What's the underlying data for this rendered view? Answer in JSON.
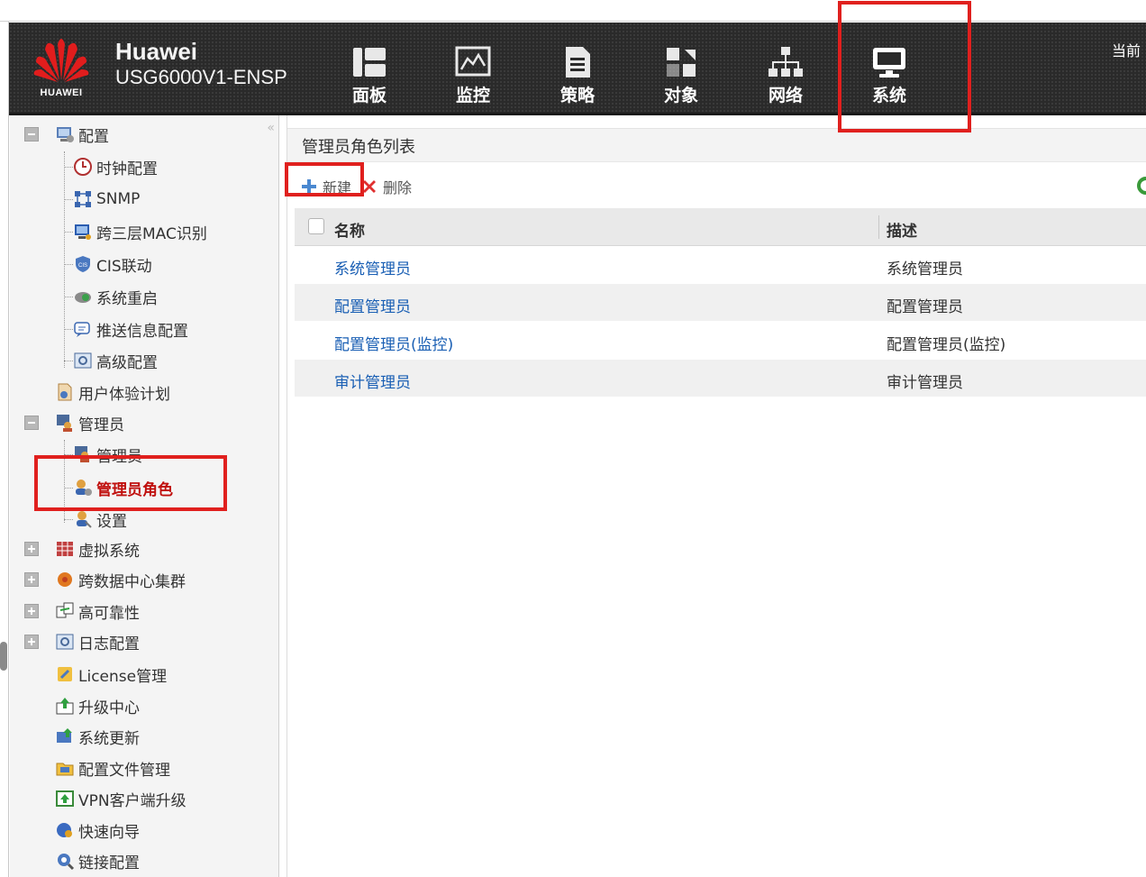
{
  "header": {
    "logo_text": "HUAWEI",
    "brand_line1": "Huawei",
    "brand_line2": "USG6000V1-ENSP",
    "current_user_prefix": "当前",
    "nav": [
      {
        "label": "面板",
        "icon": "dashboard-icon"
      },
      {
        "label": "监控",
        "icon": "monitor-chart-icon"
      },
      {
        "label": "策略",
        "icon": "policy-document-icon"
      },
      {
        "label": "对象",
        "icon": "object-icon"
      },
      {
        "label": "网络",
        "icon": "network-icon"
      },
      {
        "label": "系统",
        "icon": "system-monitor-icon",
        "active": true
      }
    ]
  },
  "sidebar": {
    "collapse_glyph": "«",
    "items": [
      {
        "label": "配置",
        "level": 0,
        "toggle": "minus",
        "icon": "config-icon"
      },
      {
        "label": "时钟配置",
        "level": 1,
        "icon": "clock-icon"
      },
      {
        "label": "SNMP",
        "level": 1,
        "icon": "snmp-icon"
      },
      {
        "label": "跨三层MAC识别",
        "level": 1,
        "icon": "mac-identify-icon"
      },
      {
        "label": "CIS联动",
        "level": 1,
        "icon": "cis-shield-icon"
      },
      {
        "label": "系统重启",
        "level": 1,
        "icon": "restart-icon"
      },
      {
        "label": "推送信息配置",
        "level": 1,
        "icon": "push-message-icon"
      },
      {
        "label": "高级配置",
        "level": 1,
        "icon": "advanced-config-icon"
      },
      {
        "label": "用户体验计划",
        "level": 0,
        "icon": "user-experience-icon"
      },
      {
        "label": "管理员",
        "level": 0,
        "toggle": "minus",
        "icon": "admin-icon"
      },
      {
        "label": "管理员",
        "level": 1,
        "icon": "admin-user-icon"
      },
      {
        "label": "管理员角色",
        "level": 1,
        "icon": "admin-role-icon",
        "active": true
      },
      {
        "label": "设置",
        "level": 1,
        "icon": "settings-user-icon"
      },
      {
        "label": "虚拟系统",
        "level": 0,
        "toggle": "plus",
        "icon": "virtual-system-icon"
      },
      {
        "label": "跨数据中心集群",
        "level": 0,
        "toggle": "plus",
        "icon": "cluster-icon"
      },
      {
        "label": "高可靠性",
        "level": 0,
        "toggle": "plus",
        "icon": "high-availability-icon"
      },
      {
        "label": "日志配置",
        "level": 0,
        "toggle": "plus",
        "icon": "log-config-icon"
      },
      {
        "label": "License管理",
        "level": 0,
        "icon": "license-icon"
      },
      {
        "label": "升级中心",
        "level": 0,
        "icon": "upgrade-center-icon"
      },
      {
        "label": "系统更新",
        "level": 0,
        "icon": "system-update-icon"
      },
      {
        "label": "配置文件管理",
        "level": 0,
        "icon": "config-file-icon"
      },
      {
        "label": "VPN客户端升级",
        "level": 0,
        "icon": "vpn-client-icon"
      },
      {
        "label": "快速向导",
        "level": 0,
        "icon": "quick-wizard-icon"
      },
      {
        "label": "链接配置",
        "level": 0,
        "icon": "link-config-icon"
      }
    ]
  },
  "main": {
    "title": "管理员角色列表",
    "toolbar": {
      "new_label": "新建",
      "delete_label": "删除"
    },
    "table": {
      "columns": [
        "名称",
        "描述"
      ],
      "rows": [
        {
          "name": "系统管理员",
          "desc": "系统管理员"
        },
        {
          "name": "配置管理员",
          "desc": "配置管理员"
        },
        {
          "name": "配置管理员(监控)",
          "desc": "配置管理员(监控)"
        },
        {
          "name": "审计管理员",
          "desc": "审计管理员"
        }
      ]
    }
  },
  "colors": {
    "header_bg": "#2a2a2a",
    "highlight": "#e0201e",
    "link": "#1a5fb4",
    "active_item": "#c0100e"
  }
}
